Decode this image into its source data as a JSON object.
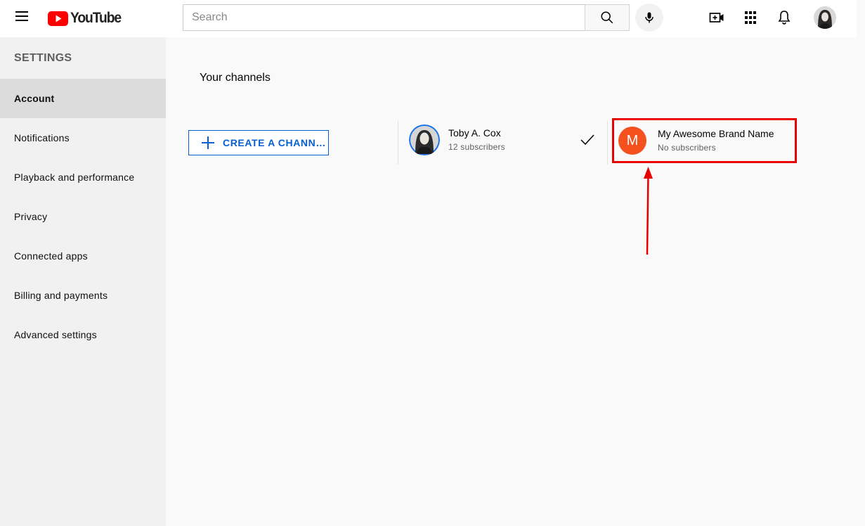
{
  "header": {
    "logo_text": "YouTube",
    "search_placeholder": "Search",
    "brand_red": "#ff0000"
  },
  "sidebar": {
    "title": "SETTINGS",
    "items": [
      {
        "label": "Account",
        "active": true
      },
      {
        "label": "Notifications"
      },
      {
        "label": "Playback and performance"
      },
      {
        "label": "Privacy"
      },
      {
        "label": "Connected apps"
      },
      {
        "label": "Billing and payments"
      },
      {
        "label": "Advanced settings"
      }
    ]
  },
  "main": {
    "title": "Your channels",
    "create_button_label": "CREATE A CHANN…",
    "channels": [
      {
        "name": "Toby A. Cox",
        "subscribers": "12 subscribers",
        "selected": true
      },
      {
        "name": "My Awesome Brand Name",
        "subscribers": "No subscribers",
        "avatar_letter": "M",
        "avatar_color": "#f4511e"
      }
    ]
  },
  "annotation": {
    "highlight_color": "#e60000"
  }
}
